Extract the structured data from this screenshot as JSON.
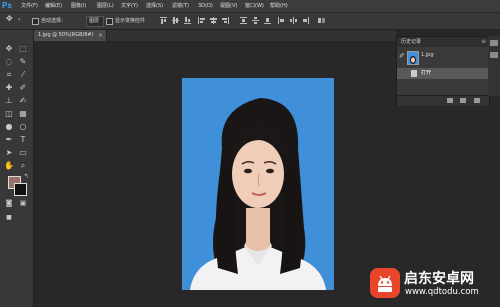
{
  "app": {
    "logo": "Ps"
  },
  "menubar": {
    "items": [
      "文件(F)",
      "编辑(E)",
      "图像(I)",
      "图层(L)",
      "文字(Y)",
      "选择(S)",
      "滤镜(T)",
      "3D(D)",
      "视图(V)",
      "窗口(W)",
      "帮助(H)"
    ]
  },
  "options": {
    "auto_select_label": "自动选择：",
    "auto_select_value": "图层",
    "show_transform_label": "显示变换控件"
  },
  "document": {
    "tab_label": "1.jpg @ 50%(RGB/8#)",
    "close": "×"
  },
  "history_panel": {
    "title": "历史记录",
    "menu_icon": "≡",
    "snapshot_label": "1.jpg",
    "state_label": "打开"
  },
  "colors": {
    "foreground": "#9b6f6a",
    "background": "#111111",
    "canvas_bg": "#3f8fd9",
    "app_bg": "#282828"
  },
  "watermark": {
    "title": "启东安卓网",
    "url": "www.qdtodu.com"
  }
}
